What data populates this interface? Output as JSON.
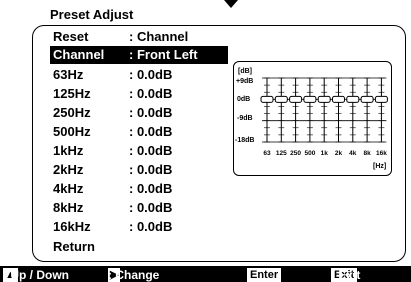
{
  "title": "Preset Adjust",
  "items": [
    {
      "label": "Reset",
      "value": ": Channel"
    },
    {
      "label": "Channel",
      "value": ": Front Left",
      "selected": true
    },
    {
      "label": "63Hz",
      "value": ": 0.0dB"
    },
    {
      "label": "125Hz",
      "value": ": 0.0dB"
    },
    {
      "label": "250Hz",
      "value": ": 0.0dB"
    },
    {
      "label": "500Hz",
      "value": ": 0.0dB"
    },
    {
      "label": "1kHz",
      "value": ": 0.0dB"
    },
    {
      "label": "2kHz",
      "value": ": 0.0dB"
    },
    {
      "label": "4kHz",
      "value": ": 0.0dB"
    },
    {
      "label": "8kHz",
      "value": ": 0.0dB"
    },
    {
      "label": "16kHz",
      "value": ": 0.0dB"
    },
    {
      "label": "Return",
      "value": ""
    }
  ],
  "graph": {
    "unit_top": "[dB]",
    "levels": [
      "+9dB",
      "0dB",
      "-9dB",
      "-18dB"
    ],
    "bands": [
      "63",
      "125",
      "250",
      "500",
      "1k",
      "2k",
      "4k",
      "8k",
      "16k"
    ],
    "band_values_db": [
      0,
      0,
      0,
      0,
      0,
      0,
      0,
      0,
      0
    ],
    "unit_bottom": "[Hz]"
  },
  "footer": {
    "updown": ": Up / Down",
    "change": ": Change",
    "enter_key": "Enter",
    "enter_text": ":",
    "exit_key": "Exit",
    "exit_text": ": Exit"
  }
}
